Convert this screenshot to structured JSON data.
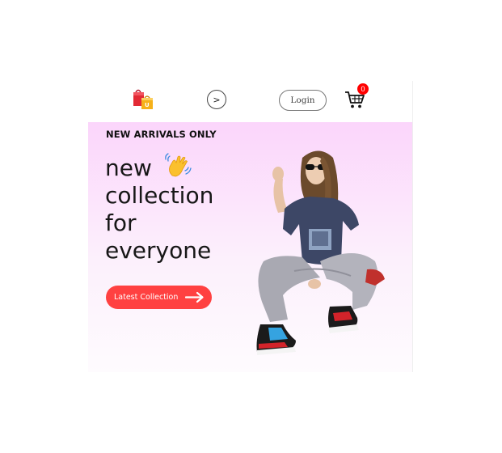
{
  "navbar": {
    "logo_icon": "shopping-bag-icon",
    "menu_toggle_label": ">",
    "login_label": "Login",
    "cart_icon": "cart-icon",
    "cart_count": "0"
  },
  "hero": {
    "kicker": "NEW ARRIVALS ONLY",
    "headline": {
      "line1": "new",
      "line2": "collection",
      "line3": "for",
      "line4": "everyone"
    },
    "wave_icon": "waving-hand-icon",
    "cta_label": "Latest Collection",
    "cta_icon": "arrow-right-icon",
    "image": "hero-model-image"
  },
  "colors": {
    "accent": "#ff4141",
    "badge": "#ff0000",
    "hero_bg_top": "#fbd5fb",
    "hero_bg_bottom": "#fefbfe"
  }
}
